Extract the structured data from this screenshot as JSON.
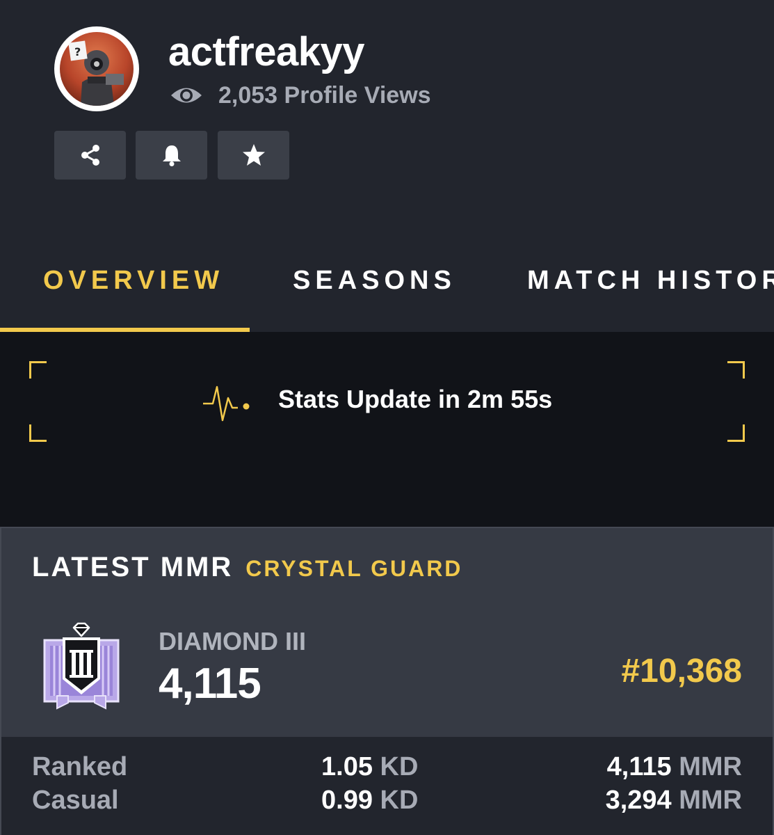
{
  "profile": {
    "username": "actfreakyy",
    "views_text": "2,053 Profile Views"
  },
  "actions": [
    {
      "icon": "share-icon"
    },
    {
      "icon": "bell-icon"
    },
    {
      "icon": "star-icon"
    }
  ],
  "tabs": [
    {
      "label": "OVERVIEW",
      "active": true
    },
    {
      "label": "SEASONS",
      "active": false
    },
    {
      "label": "MATCH HISTORY",
      "active": false
    }
  ],
  "update": {
    "text": "Stats Update in 2m 55s",
    "icon": "pulse-icon"
  },
  "mmr": {
    "title": "LATEST MMR",
    "season": "CRYSTAL GUARD",
    "rank_name": "DIAMOND III",
    "rank_icon": "diamond-rank-icon",
    "value": "4,115",
    "position": "#10,368"
  },
  "stats": [
    {
      "label": "Ranked",
      "kd_value": "1.05",
      "kd_unit": "KD",
      "mmr_value": "4,115",
      "mmr_unit": "MMR"
    },
    {
      "label": "Casual",
      "kd_value": "0.99",
      "kd_unit": "KD",
      "mmr_value": "3,294",
      "mmr_unit": "MMR"
    }
  ],
  "colors": {
    "accent": "#f2c94c",
    "background": "#22252d",
    "panel": "#111318",
    "card": "#363a44",
    "muted_text": "#a7abb5"
  }
}
